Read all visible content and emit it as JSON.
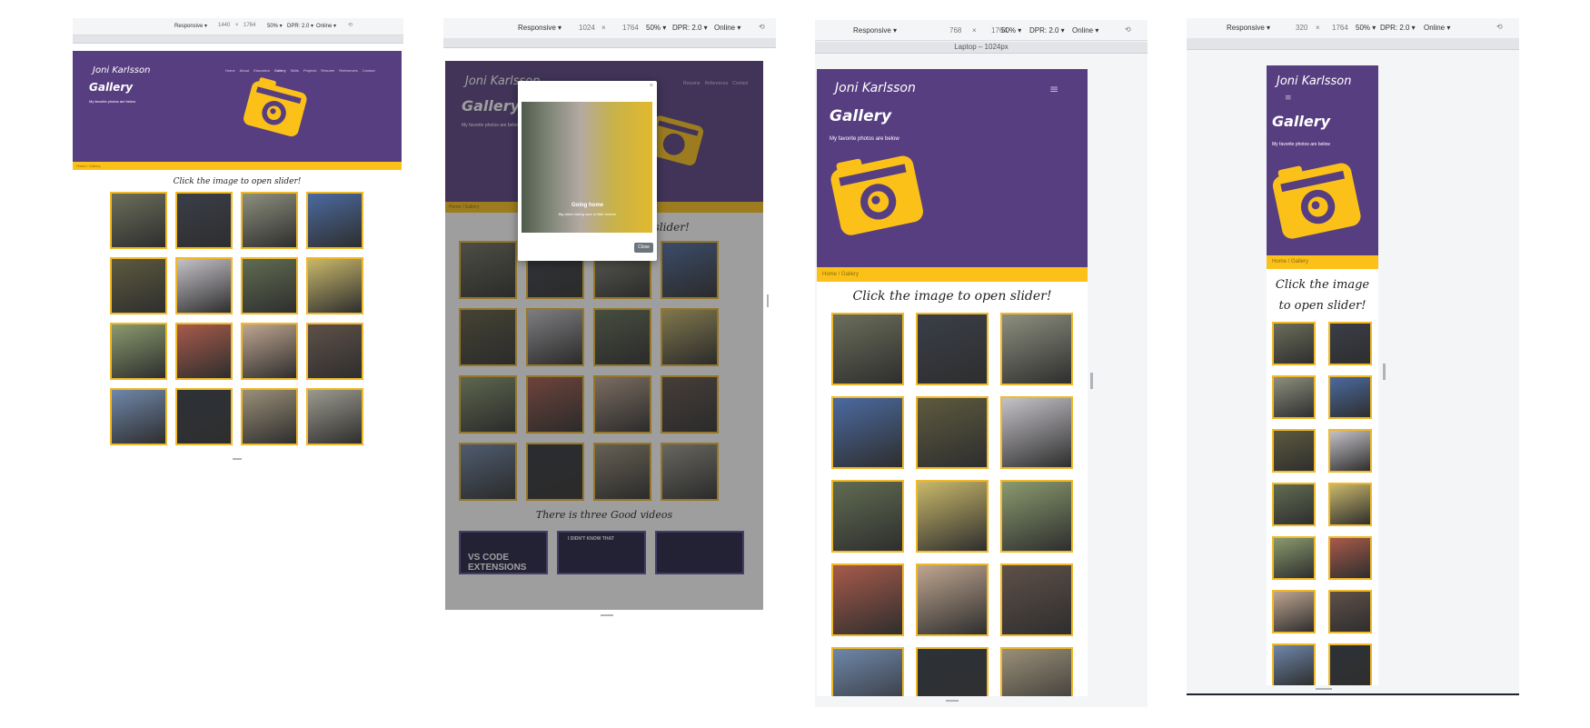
{
  "site": {
    "logo": "Joni Karlsson",
    "page_title": "Gallery",
    "subtitle": "My favorite photos are below",
    "nav": [
      "Home",
      "About",
      "Education",
      "Gallery",
      "Skills",
      "Projects",
      "Resume",
      "References",
      "Contact"
    ],
    "active_nav": "Gallery",
    "breadcrumb": "Home / Gallery",
    "heading": "Click the image to open slider!",
    "videos_heading": "There is three Good videos",
    "videos": [
      "VS CODE EXTENSIONS",
      "I DIDN'T KNOW THAT",
      ""
    ],
    "camera_color": "#fbc119",
    "hero_color": "#573e80"
  },
  "tiles": [
    "#6b6e5a",
    "#3a3e48",
    "#8d8f7e",
    "#4b6aa0",
    "#5d5a3e",
    "#c5c2c8",
    "#616c52",
    "#c9b86a",
    "#8a9a6e",
    "#a85a4a",
    "#bfa590",
    "#5f5048",
    "#6f87aa",
    "#2d3238",
    "#9a8f78",
    "#9c9a8e",
    "#7a6a5a",
    "#555560",
    "#8f7a6a",
    "#6a5a52"
  ],
  "modal": {
    "close_x": "×",
    "caption_title": "Going home",
    "caption_text": "Big sister taking care of little brother",
    "close_label": "Close"
  },
  "panes": [
    {
      "responsive": "Responsive ▾",
      "width": "1440",
      "height": "1764",
      "x": "×",
      "zoom": "50% ▾",
      "dpr": "DPR: 2.0 ▾",
      "net": "Online ▾",
      "rotate": "⟲"
    },
    {
      "responsive": "Responsive ▾",
      "width": "1024",
      "height": "1764",
      "x": "×",
      "zoom": "50% ▾",
      "dpr": "DPR: 2.0 ▾",
      "net": "Online ▾",
      "rotate": "⟲"
    },
    {
      "responsive": "Responsive ▾",
      "width": "768",
      "height": "1764",
      "x": "×",
      "zoom": "50% ▾",
      "dpr": "DPR: 2.0 ▾",
      "net": "Online ▾",
      "rotate": "⟲",
      "ruler_label": "Laptop – 1024px"
    },
    {
      "responsive": "Responsive ▾",
      "width": "320",
      "height": "1764",
      "x": "×",
      "zoom": "50% ▾",
      "dpr": "DPR: 2.0 ▾",
      "net": "Online ▾",
      "rotate": "⟲"
    }
  ]
}
